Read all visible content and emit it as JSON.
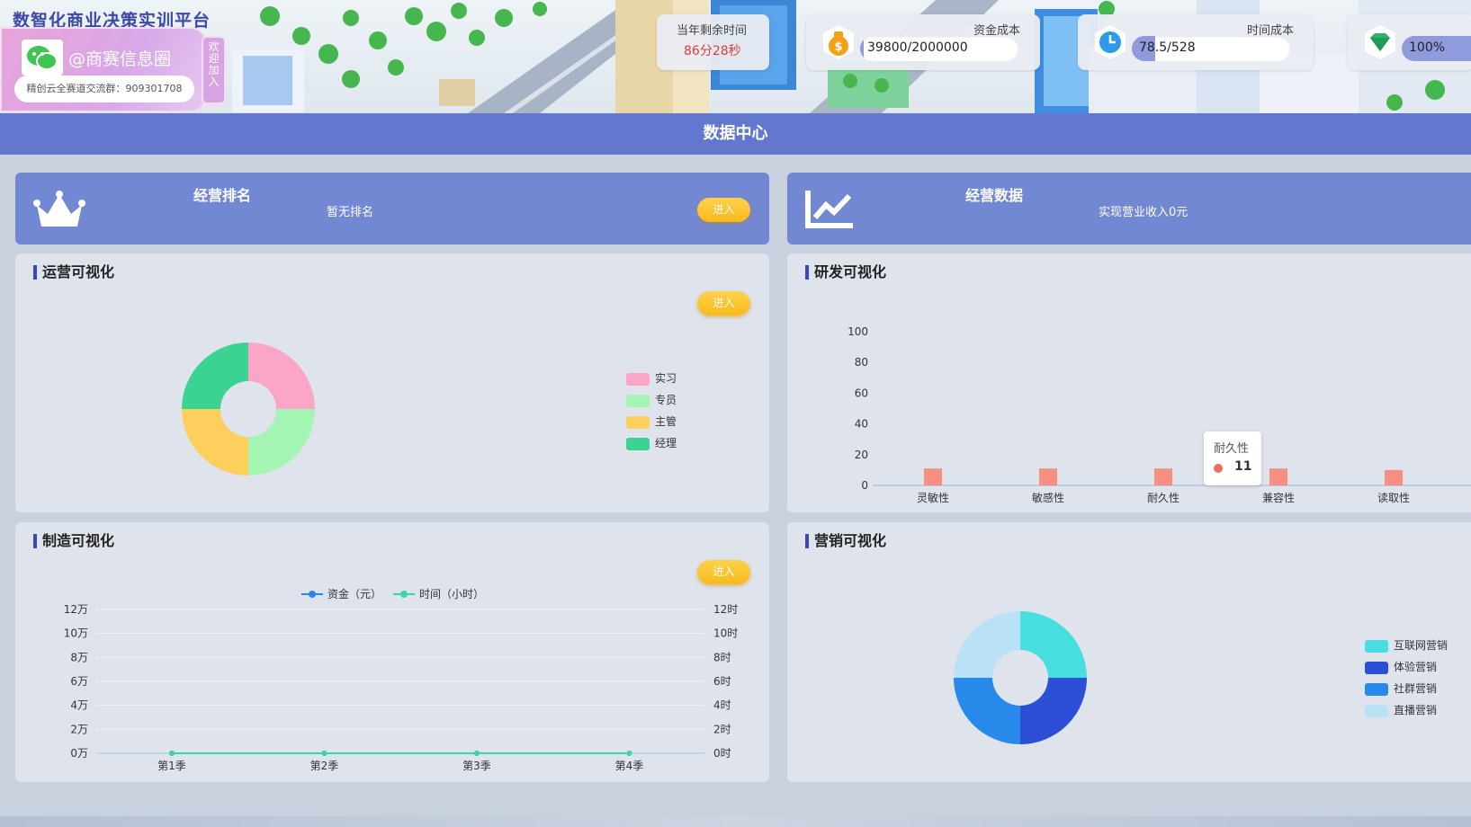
{
  "header": {
    "brand_title": "数智化商业决策实训平台",
    "wechat_handle": "@商赛信息圈",
    "wechat_group": "精创云全赛道交流群：909301708",
    "join_label": "欢迎加入"
  },
  "stats": {
    "time_left_label": "当年剩余时间",
    "time_left_value": "86分28秒",
    "capital_label": "资金成本",
    "capital_value": "39800/2000000",
    "capital_progress": 0.02,
    "time_cost_label": "时间成本",
    "time_cost_value": "78.5/528",
    "time_cost_progress": 0.149,
    "quality_value": "100%",
    "quality_progress": 1.0,
    "icons": [
      "money-bag-icon",
      "clock-icon",
      "diamond-icon"
    ]
  },
  "page_title": "数据中心",
  "ranking": {
    "title": "经营排名",
    "subtitle": "暂无排名",
    "enter_label": "进入",
    "icon": "crown-icon"
  },
  "business": {
    "title": "经营数据",
    "subtitle": "实现营业收入0元",
    "icon": "line-chart-icon"
  },
  "operations": {
    "title": "运营可视化",
    "enter_label": "进入"
  },
  "rnd": {
    "title": "研发可视化",
    "tooltip_label": "耐久性",
    "tooltip_value": "11"
  },
  "manufacturing": {
    "title": "制造可视化",
    "enter_label": "进入"
  },
  "marketing": {
    "title": "营销可视化"
  },
  "colors": {
    "primary": "#6277cd",
    "card": "#7388d3",
    "enter_button": "#f9b91c",
    "countdown": "#e03a3a"
  },
  "chart_data": [
    {
      "id": "operations",
      "type": "pie",
      "title": "",
      "labels": [
        "实习",
        "专员",
        "主管",
        "经理"
      ],
      "values": [
        1,
        1,
        1,
        1
      ],
      "colors": [
        "#fca5c9",
        "#a4f5b4",
        "#fdd05e",
        "#3bd391"
      ],
      "legend": "right"
    },
    {
      "id": "rnd",
      "type": "bar",
      "title": "",
      "categories": [
        "灵敏性",
        "敏感性",
        "耐久性",
        "兼容性",
        "读取性"
      ],
      "values": [
        11,
        11,
        11,
        11,
        10
      ],
      "ylim": [
        0,
        100
      ],
      "yticks": [
        "0",
        "20",
        "40",
        "60",
        "80",
        "100"
      ],
      "color": "#f88070"
    },
    {
      "id": "manufacturing",
      "type": "line",
      "title": "",
      "categories": [
        "第1季",
        "第2季",
        "第3季",
        "第4季"
      ],
      "series": [
        {
          "name": "资金（元）",
          "values": [
            0,
            0,
            0,
            0
          ],
          "color": "#2c84e8"
        },
        {
          "name": "时间（小时）",
          "values": [
            0,
            0,
            0,
            0
          ],
          "color": "#3fd3a8"
        }
      ],
      "yticks_left": [
        "0万",
        "2万",
        "4万",
        "6万",
        "8万",
        "10万",
        "12万"
      ],
      "yticks_right": [
        "0时",
        "2时",
        "4时",
        "6时",
        "8时",
        "10时",
        "12时"
      ],
      "legend": "top"
    },
    {
      "id": "marketing",
      "type": "pie",
      "title": "",
      "labels": [
        "互联网营销",
        "体验营销",
        "社群营销",
        "直播营销"
      ],
      "values": [
        1,
        1,
        1,
        1
      ],
      "colors": [
        "#47dedf",
        "#2d4fd7",
        "#2789ea",
        "#b9e2f7"
      ],
      "legend": "right"
    }
  ]
}
